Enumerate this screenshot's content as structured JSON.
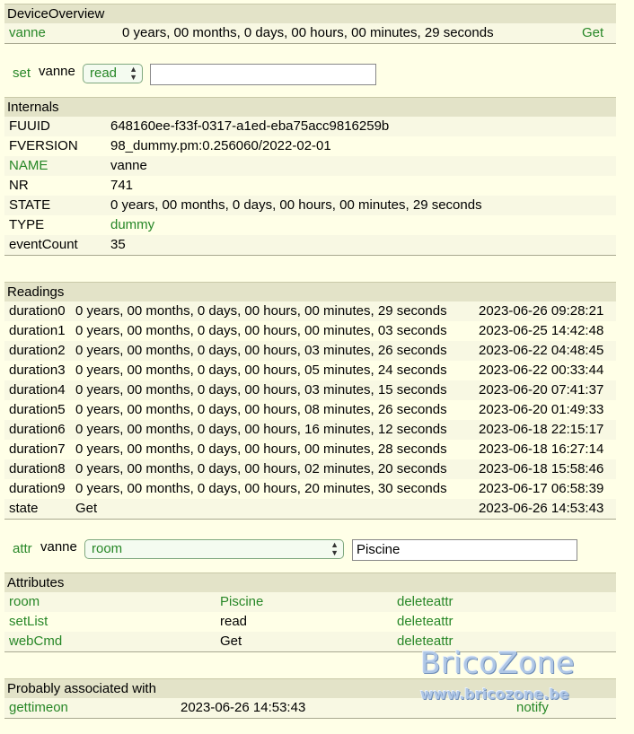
{
  "device_overview": {
    "title": "DeviceOverview",
    "device": "vanne",
    "state": "0 years, 00 months, 0 days, 00 hours, 00 minutes, 29 seconds",
    "cmd": "Get"
  },
  "set_control": {
    "label": "set",
    "device": "vanne",
    "selected": "read",
    "value": ""
  },
  "internals": {
    "title": "Internals",
    "rows": [
      {
        "key": "FUUID",
        "value": "648160ee-f33f-0317-a1ed-eba75acc9816259b"
      },
      {
        "key": "FVERSION",
        "value": "98_dummy.pm:0.256060/2022-02-01"
      },
      {
        "key": "NAME",
        "value": "vanne"
      },
      {
        "key": "NR",
        "value": "741"
      },
      {
        "key": "STATE",
        "value": "0 years, 00 months, 0 days, 00 hours, 00 minutes, 29 seconds"
      },
      {
        "key": "TYPE",
        "value": "dummy"
      },
      {
        "key": "eventCount",
        "value": "35"
      }
    ]
  },
  "readings": {
    "title": "Readings",
    "rows": [
      {
        "name": "duration0",
        "value": "0 years, 00 months, 0 days, 00 hours, 00 minutes, 29 seconds",
        "time": "2023-06-26 09:28:21"
      },
      {
        "name": "duration1",
        "value": "0 years, 00 months, 0 days, 00 hours, 00 minutes, 03 seconds",
        "time": "2023-06-25 14:42:48"
      },
      {
        "name": "duration2",
        "value": "0 years, 00 months, 0 days, 00 hours, 03 minutes, 26 seconds",
        "time": "2023-06-22 04:48:45"
      },
      {
        "name": "duration3",
        "value": "0 years, 00 months, 0 days, 00 hours, 05 minutes, 24 seconds",
        "time": "2023-06-22 00:33:44"
      },
      {
        "name": "duration4",
        "value": "0 years, 00 months, 0 days, 00 hours, 03 minutes, 15 seconds",
        "time": "2023-06-20 07:41:37"
      },
      {
        "name": "duration5",
        "value": "0 years, 00 months, 0 days, 00 hours, 08 minutes, 26 seconds",
        "time": "2023-06-20 01:49:33"
      },
      {
        "name": "duration6",
        "value": "0 years, 00 months, 0 days, 00 hours, 16 minutes, 12 seconds",
        "time": "2023-06-18 22:15:17"
      },
      {
        "name": "duration7",
        "value": "0 years, 00 months, 0 days, 00 hours, 00 minutes, 28 seconds",
        "time": "2023-06-18 16:27:14"
      },
      {
        "name": "duration8",
        "value": "0 years, 00 months, 0 days, 00 hours, 02 minutes, 20 seconds",
        "time": "2023-06-18 15:58:46"
      },
      {
        "name": "duration9",
        "value": "0 years, 00 months, 0 days, 00 hours, 20 minutes, 30 seconds",
        "time": "2023-06-17 06:58:39"
      },
      {
        "name": "state",
        "value": "Get",
        "time": "2023-06-26 14:53:43"
      }
    ]
  },
  "attr_control": {
    "label": "attr",
    "device": "vanne",
    "selected": "room",
    "value": "Piscine"
  },
  "attributes": {
    "title": "Attributes",
    "rows": [
      {
        "name": "room",
        "value": "Piscine",
        "action": "deleteattr"
      },
      {
        "name": "setList",
        "value": "read",
        "action": "deleteattr"
      },
      {
        "name": "webCmd",
        "value": "Get",
        "action": "deleteattr"
      }
    ]
  },
  "associated": {
    "title": "Probably associated with",
    "rows": [
      {
        "name": "gettimeon",
        "time": "2023-06-26 14:53:43",
        "action": "notify"
      }
    ]
  },
  "watermark": {
    "line1": "BricoZone",
    "line2": "www.bricozone.be"
  },
  "colors": {
    "background": "#FFFFE7",
    "header": "#E3E3C8",
    "link": "#278727",
    "watermark": "#AFC7E6"
  }
}
